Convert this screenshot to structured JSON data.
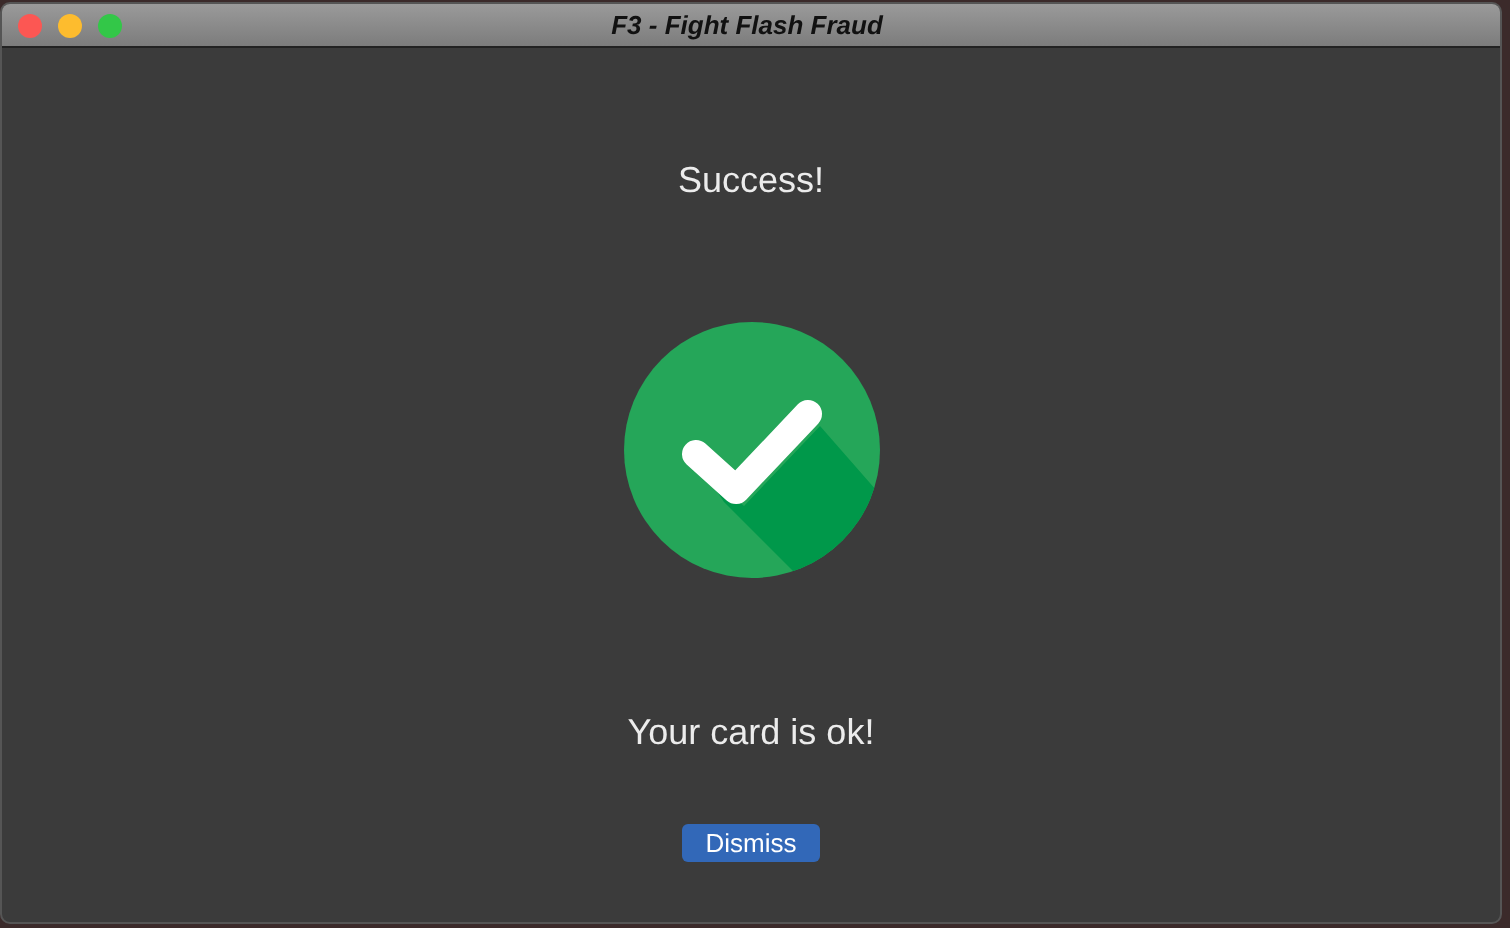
{
  "window": {
    "title": "F3 - Fight Flash Fraud"
  },
  "heading": "Success!",
  "message": "Your card is ok!",
  "buttons": [
    "Dismiss"
  ]
}
